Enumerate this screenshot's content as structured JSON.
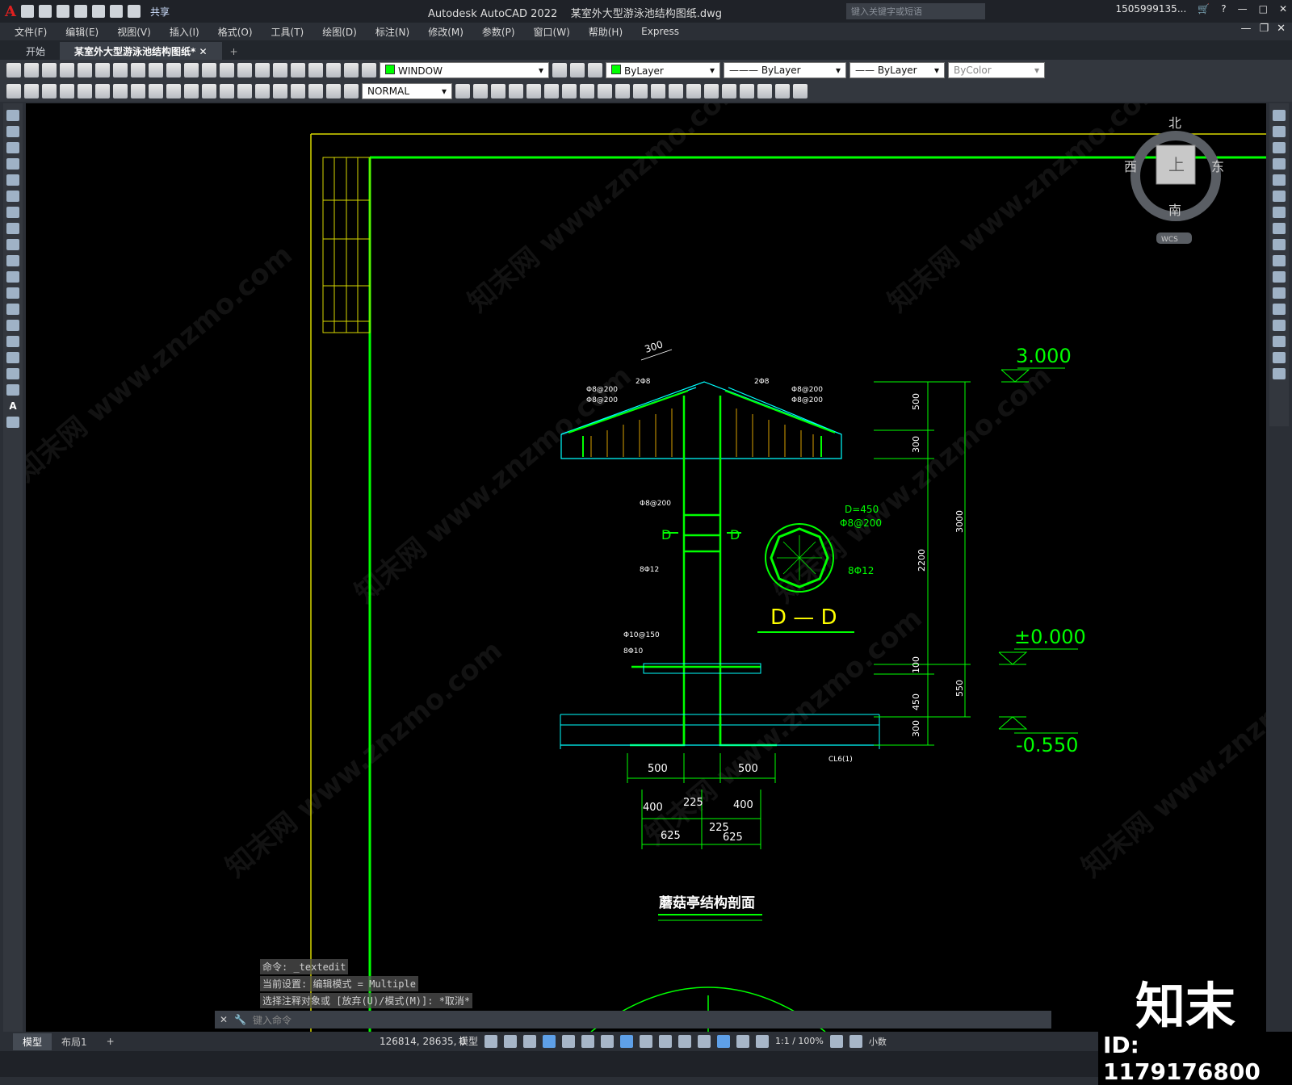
{
  "titlebar": {
    "app_name": "Autodesk AutoCAD 2022",
    "doc_name": "某室外大型游泳池结构图纸.dwg",
    "share_label": "共享",
    "search_placeholder": "键入关键字或短语",
    "user": "1505999135...",
    "help": "?"
  },
  "menu": [
    "文件(F)",
    "编辑(E)",
    "视图(V)",
    "插入(I)",
    "格式(O)",
    "工具(T)",
    "绘图(D)",
    "标注(N)",
    "修改(M)",
    "参数(P)",
    "窗口(W)",
    "帮助(H)",
    "Express"
  ],
  "tabs": {
    "start": "开始",
    "active": "某室外大型游泳池结构图纸*",
    "add": "+"
  },
  "toolbar1": {
    "workspace": "WINDOW",
    "layer_color": "ByLayer",
    "linetype": "ByLayer",
    "lineweight": "ByLayer",
    "plotstyle": "ByColor"
  },
  "toolbar2": {
    "dimstyle": "NORMAL"
  },
  "viewcube": {
    "north": "北",
    "south": "南",
    "west": "西",
    "east": "东",
    "top": "上",
    "wcs": "WCS"
  },
  "drawing": {
    "title": "蘑菇亭结构剖面",
    "elev_top": "3.000",
    "elev_zero": "±0.000",
    "elev_bottom": "-0.550",
    "section_label": "D — D",
    "section_mark": "D",
    "dims_right": [
      "500",
      "300",
      "2200",
      "3000",
      "100",
      "550",
      "450",
      "300"
    ],
    "dims_bottom": [
      "500",
      "500",
      "400",
      "225",
      "400",
      "225",
      "625",
      "625"
    ],
    "dim_top": "300",
    "labels": {
      "rebar_left1": "Φ8@200",
      "rebar_left2": "Φ8@200",
      "rebar_right1": "Φ8@200",
      "rebar_right2": "Φ8@200",
      "two_bars_left": "2Φ8",
      "two_bars_right": "2Φ8",
      "col_stirrup": "Φ8@200",
      "col_main": "8Φ12",
      "slab_stirrup": "Φ10@150",
      "slab_bar": "8Φ10",
      "dia": "D=450",
      "circ_stirrup": "Φ8@200",
      "circ_main": "8Φ12",
      "cl": "CL6(1)"
    }
  },
  "command": {
    "history": [
      "命令: _textedit",
      "当前设置: 编辑模式 = Multiple",
      "选择注释对象或 [放弃(U)/模式(M)]: *取消*"
    ],
    "input_placeholder": "键入命令"
  },
  "status": {
    "model_tab": "模型",
    "layout_tab": "布局1",
    "add": "+",
    "coords": "126814, 28635, 0",
    "mode": "模型",
    "scale": "1:1 / 100%",
    "units": "小数"
  },
  "watermark": {
    "brand": "知末",
    "id": "ID: 1179176800",
    "site": "知末网 www.znzmo.com"
  },
  "colors": {
    "green": "#00ff00",
    "cyan": "#00ffff",
    "yellow": "#ffff00",
    "white": "#ffffff"
  }
}
